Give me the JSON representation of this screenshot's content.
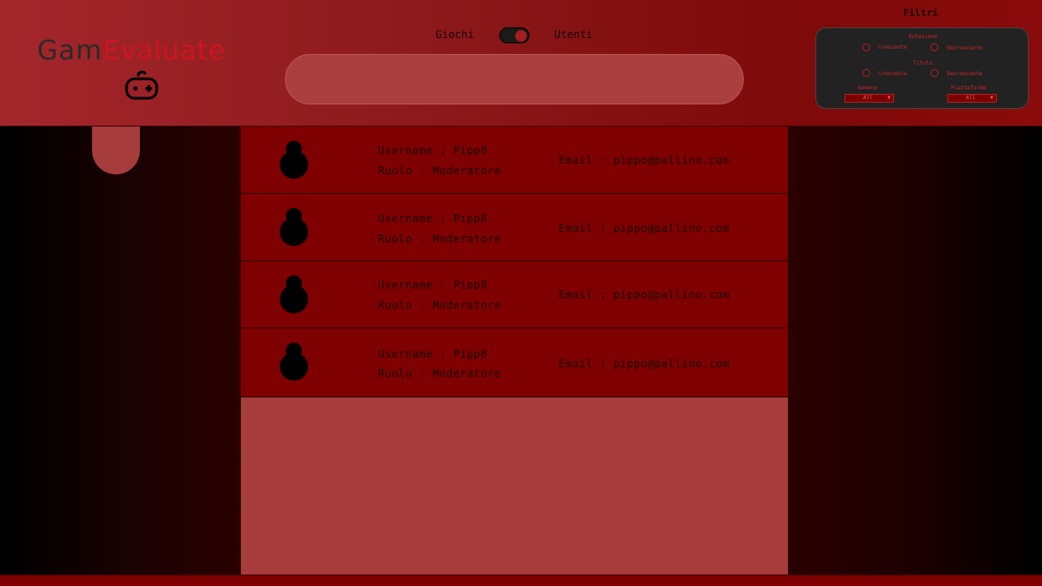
{
  "brand": {
    "part1": "Gam",
    "part2": "Evaluate"
  },
  "toggle": {
    "left_label": "Giochi",
    "right_label": "Utenti",
    "state": "Utenti"
  },
  "search": {
    "value": "",
    "placeholder": ""
  },
  "filters": {
    "title": "Filtri",
    "votazione": {
      "label": "Votazione",
      "opt1": "Crescente",
      "opt2": "Decrescente"
    },
    "titolo": {
      "label": "Titolo",
      "opt1": "Crescente",
      "opt2": "Decrescente"
    },
    "genere": {
      "label": "Genere",
      "value": "All"
    },
    "piattaforma": {
      "label": "Piattaforme",
      "value": "All"
    }
  },
  "users": [
    {
      "username": "Username : Pipp8",
      "role": "Ruolo : Moderatore",
      "email": "Email : pippo@pallino.com"
    },
    {
      "username": "Username : Pipp8",
      "role": "Ruolo : Moderatore",
      "email": "Email : pippo@pallino.com"
    },
    {
      "username": "Username : Pipp8",
      "role": "Ruolo : Moderatore",
      "email": "Email : pippo@pallino.com"
    },
    {
      "username": "Username : Pipp8",
      "role": "Ruolo : Moderatore",
      "email": "Email : pippo@pallino.com"
    }
  ],
  "colors": {
    "accent": "#d0141e",
    "row": "#7e0000",
    "panel": "#a63c3c"
  }
}
